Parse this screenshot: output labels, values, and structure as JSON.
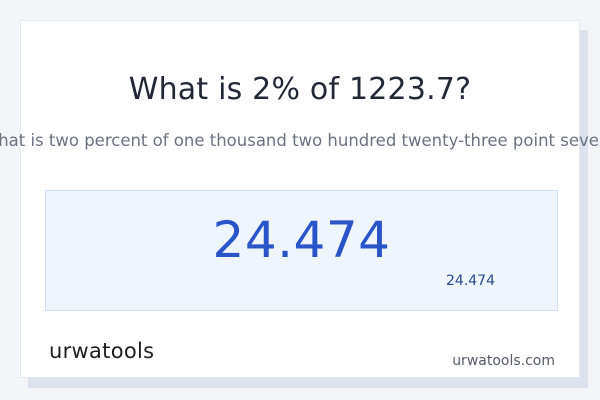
{
  "page": {
    "title": "What is 2% of 1223.7?",
    "subtitle": "What is two percent of one thousand two hundred twenty-three point seven?",
    "result_main": "24.474",
    "result_small": "24.474"
  },
  "footer": {
    "logo_text": "urwatools",
    "domain": "urwatools.com"
  },
  "colors": {
    "accent": "#2a55c9",
    "logo_dot": "#f2a31b",
    "result_bg": "#eef5ff"
  }
}
